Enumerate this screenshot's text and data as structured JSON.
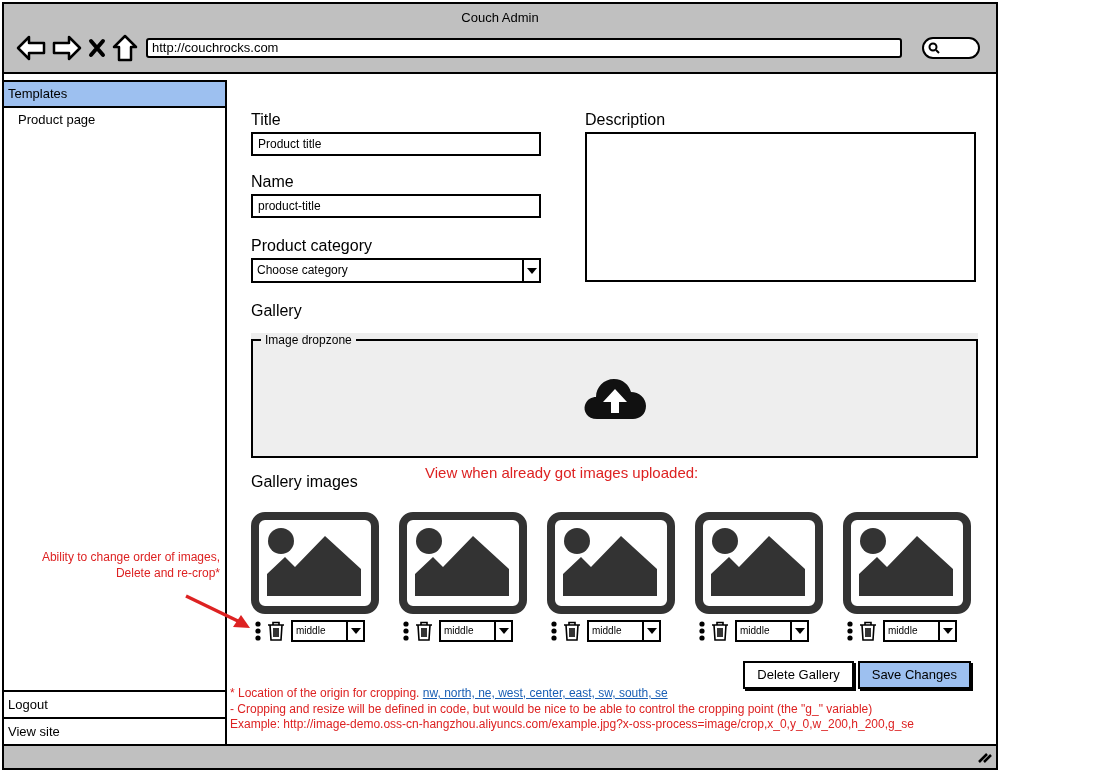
{
  "window": {
    "title": "Couch Admin"
  },
  "browser": {
    "url": "http://couchrocks.com"
  },
  "sidebar": {
    "items": [
      {
        "label": "Templates",
        "kind": "header",
        "selected": true
      },
      {
        "label": "Product page",
        "kind": "item",
        "selected": false
      }
    ],
    "footer_items": [
      "Logout",
      "View site"
    ]
  },
  "form": {
    "title": {
      "label": "Title",
      "value": "Product title"
    },
    "name": {
      "label": "Name",
      "value": "product-title"
    },
    "category": {
      "label": "Product category",
      "value": "Choose category"
    },
    "description": {
      "label": "Description"
    }
  },
  "gallery": {
    "label": "Gallery",
    "dropzone_label": "Image dropzone",
    "images_label": "Gallery images",
    "images": [
      {
        "crop": "middle"
      },
      {
        "crop": "middle"
      },
      {
        "crop": "middle"
      },
      {
        "crop": "middle"
      },
      {
        "crop": "middle"
      }
    ]
  },
  "buttons": [
    {
      "label": "Delete Gallery",
      "primary": false
    },
    {
      "label": "Save Changes",
      "primary": true
    }
  ],
  "annotations": {
    "uploaded_note": "View when already got images uploaded:",
    "side_note": [
      "Ability to change order of images,",
      "Delete and re-crop*"
    ],
    "footnotes": [
      {
        "text": "* Location of the origin for cropping. ",
        "link": "nw, north, ne, west, center, east, sw, south, se"
      },
      {
        "text": "- Cropping and resize will be defined in code, but would be nice to be able to control the cropping point (the \"g_\" variable)"
      },
      {
        "text": "Example: http://image-demo.oss-cn-hangzhou.aliyuncs.com/example.jpg?x-oss-process=image/crop,x_0,y_0,w_200,h_200,g_se"
      }
    ]
  }
}
